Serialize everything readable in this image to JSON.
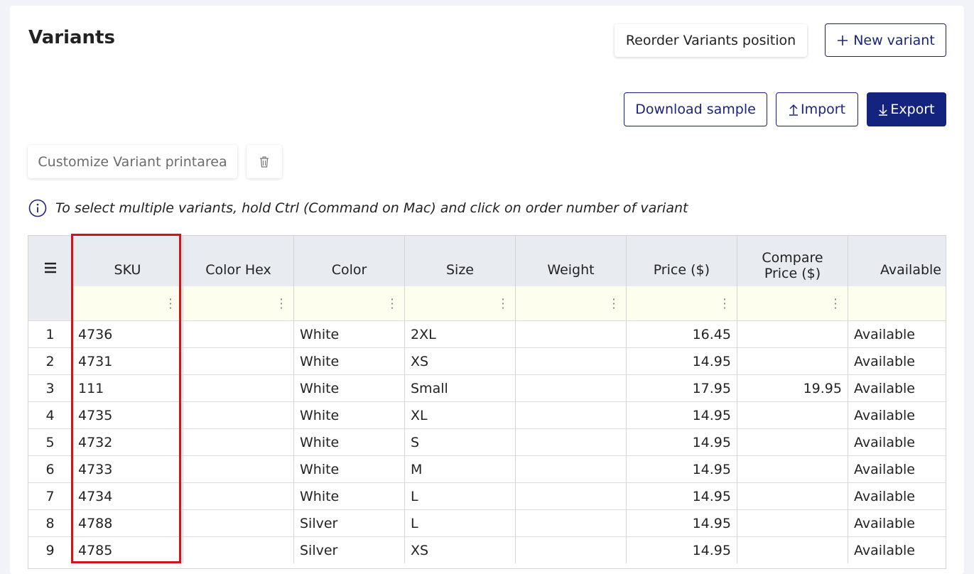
{
  "page": {
    "title": "Variants"
  },
  "toolbar": {
    "reorder_label": "Reorder Variants position",
    "new_variant_label": "New variant",
    "download_sample_label": "Download sample",
    "import_label": "Import",
    "export_label": "Export",
    "customize_label": "Customize Variant printarea"
  },
  "info": {
    "text": "To select multiple variants, hold Ctrl (Command on Mac) and click on order number of variant"
  },
  "grid": {
    "columns": [
      "SKU",
      "Color Hex",
      "Color",
      "Size",
      "Weight",
      "Price ($)",
      "Compare\nPrice ($)",
      "Available"
    ],
    "compare_line1": "Compare",
    "compare_line2": "Price ($)",
    "rows": [
      {
        "n": "1",
        "sku": "4736",
        "hex": "",
        "color": "White",
        "size": "2XL",
        "weight": "",
        "price": "16.45",
        "compare": "",
        "available": "Available"
      },
      {
        "n": "2",
        "sku": "4731",
        "hex": "",
        "color": "White",
        "size": "XS",
        "weight": "",
        "price": "14.95",
        "compare": "",
        "available": "Available"
      },
      {
        "n": "3",
        "sku": "111",
        "hex": "",
        "color": "White",
        "size": "Small",
        "weight": "",
        "price": "17.95",
        "compare": "19.95",
        "available": "Available"
      },
      {
        "n": "4",
        "sku": "4735",
        "hex": "",
        "color": "White",
        "size": "XL",
        "weight": "",
        "price": "14.95",
        "compare": "",
        "available": "Available"
      },
      {
        "n": "5",
        "sku": "4732",
        "hex": "",
        "color": "White",
        "size": "S",
        "weight": "",
        "price": "14.95",
        "compare": "",
        "available": "Available"
      },
      {
        "n": "6",
        "sku": "4733",
        "hex": "",
        "color": "White",
        "size": "M",
        "weight": "",
        "price": "14.95",
        "compare": "",
        "available": "Available"
      },
      {
        "n": "7",
        "sku": "4734",
        "hex": "",
        "color": "White",
        "size": "L",
        "weight": "",
        "price": "14.95",
        "compare": "",
        "available": "Available"
      },
      {
        "n": "8",
        "sku": "4788",
        "hex": "",
        "color": "Silver",
        "size": "L",
        "weight": "",
        "price": "14.95",
        "compare": "",
        "available": "Available"
      },
      {
        "n": "9",
        "sku": "4785",
        "hex": "",
        "color": "Silver",
        "size": "XS",
        "weight": "",
        "price": "14.95",
        "compare": "",
        "available": "Available"
      }
    ]
  },
  "colors": {
    "accent": "#1a237e",
    "highlight": "#d0141a",
    "filter_bg": "#fefeee",
    "header_bg": "#e8ebf0"
  },
  "icons": {
    "menu": "hamburger-icon",
    "trash": "trash-icon",
    "info": "info-icon",
    "plus": "plus-icon",
    "upload": "upload-icon",
    "download": "download-icon",
    "filter": "kebab-icon"
  }
}
